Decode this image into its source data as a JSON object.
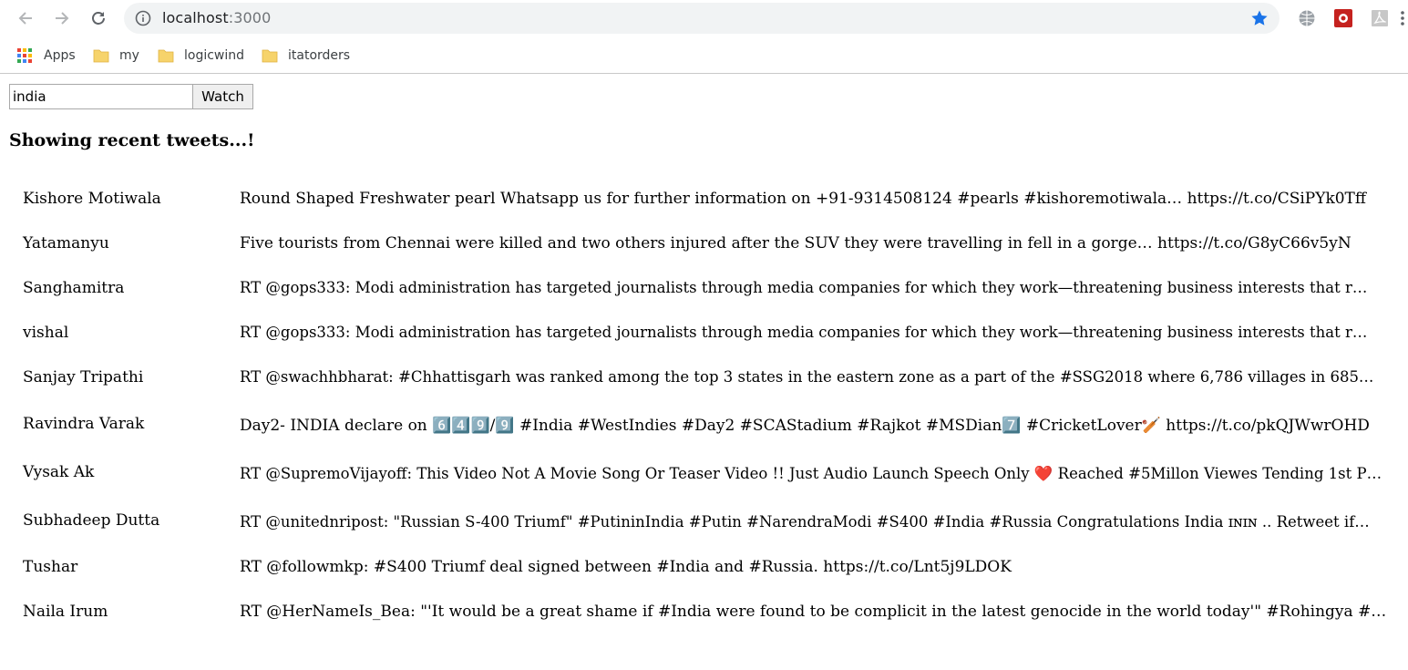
{
  "browser": {
    "url_host": "localhost",
    "url_port": ":3000",
    "bookmarks": [
      {
        "label": "Apps",
        "icon": "apps-grid-icon"
      },
      {
        "label": "my",
        "icon": "folder-icon"
      },
      {
        "label": "logicwind",
        "icon": "folder-icon"
      },
      {
        "label": "itatorders",
        "icon": "folder-icon"
      }
    ],
    "colors": {
      "star": "#1a73e8",
      "folder": "#f6d36b",
      "omnibox": "#f1f3f4"
    }
  },
  "search": {
    "value": "india",
    "button_label": "Watch"
  },
  "heading": "Showing recent tweets...!",
  "tweets": [
    {
      "author": "Kishore Motiwala",
      "text": "Round Shaped Freshwater pearl Whatsapp us for further information on +91-9314508124 #pearls #kishoremotiwala… https://t.co/CSiPYk0Tff"
    },
    {
      "author": "Yatamanyu",
      "text": "Five tourists from Chennai were killed and two others injured after the SUV they were travelling in fell in a gorge… https://t.co/G8yC66v5yN"
    },
    {
      "author": "Sanghamitra",
      "text": "RT @gops333: Modi administration has targeted journalists through media companies for which they work—threatening business interests that r…"
    },
    {
      "author": "vishal",
      "text": "RT @gops333: Modi administration has targeted journalists through media companies for which they work—threatening business interests that r…"
    },
    {
      "author": "Sanjay Tripathi",
      "text": "RT @swachhbharat: #Chhattisgarh was ranked among the top 3 states in the eastern zone as a part of the #SSG2018 where 6,786 villages in 685…"
    },
    {
      "author": "Ravindra Varak",
      "text": "Day2- INDIA declare on 6️⃣4️⃣9️⃣/9️⃣ #India #WestIndies #Day2 #SCAStadium #Rajkot #MSDian7️⃣ #CricketLover🏏 https://t.co/pkQJWwrOHD"
    },
    {
      "author": "Vysak Ak",
      "text": "RT @SupremoVijayoff: This Video Not A Movie Song Or Teaser Video !! Just Audio Launch Speech Only ❤️ Reached #5Millon Viewes Tending 1st P…"
    },
    {
      "author": "Subhadeep Dutta",
      "text": "RT @unitednripost: \"Russian S-400 Triumf\" #PutininIndia #Putin #NarendraModi #S400 #India #Russia Congratulations India ɪɴɪɴ .. Retweet if…"
    },
    {
      "author": "Tushar",
      "text": "RT @followmkp: #S400 Triumf deal signed between #India and #Russia. https://t.co/Lnt5j9LDOK"
    },
    {
      "author": "Naila Irum",
      "text": "RT @HerNameIs_Bea: \"'It would be a great shame if #India were found to be complicit in the latest genocide in the world today'\" #Rohingya #…"
    }
  ]
}
